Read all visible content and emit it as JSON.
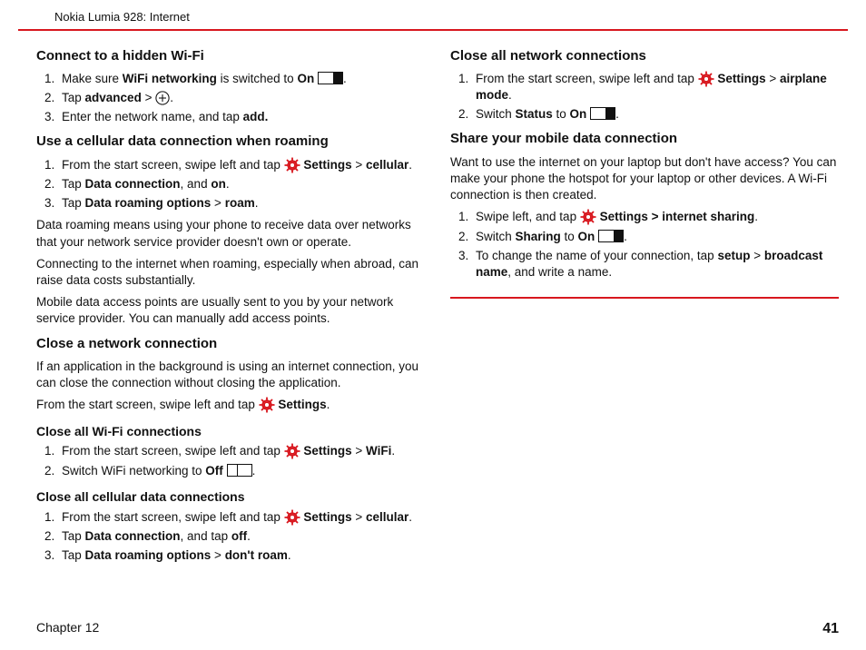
{
  "header": "Nokia Lumia 928: Internet",
  "chapter": "Chapter 12",
  "page": "41",
  "left": {
    "s1": {
      "title": "Connect to a hidden Wi‑Fi",
      "li1a": "Make sure ",
      "li1b": "WiFi networking",
      "li1c": " is switched to ",
      "li1d": "On",
      "li1e": " ",
      "li2a": "Tap ",
      "li2b": "advanced",
      "li2c": " > ",
      "li3a": "Enter the network name, and tap ",
      "li3b": "add."
    },
    "s2": {
      "title": "Use a cellular data connection when roaming",
      "li1a": "From the start screen, swipe left and tap ",
      "li1b": " Settings",
      "li1c": " > ",
      "li1d": "cellular",
      "li1e": ".",
      "li2a": "Tap ",
      "li2b": "Data connection",
      "li2c": ", and ",
      "li2d": "on",
      "li2e": ".",
      "li3a": "Tap ",
      "li3b": "Data roaming options",
      "li3c": " > ",
      "li3d": "roam",
      "li3e": ".",
      "p1": "Data roaming means using your phone to receive data over networks that your network service provider doesn't own or operate.",
      "p2": "Connecting to the internet when roaming, especially when abroad, can raise data costs substantially.",
      "p3": "Mobile data access points are usually sent to you by your network service provider. You can manually add access points."
    },
    "s3": {
      "title": "Close a network connection",
      "p1": "If an application in the background is using an internet connection, you can close the connection without closing the application.",
      "p2a": "From the start screen, swipe left and tap ",
      "p2b": " Settings",
      "p2c": "."
    },
    "s4": {
      "title": "Close all Wi‑Fi connections",
      "li1a": "From the start screen, swipe left and tap ",
      "li1b": " Settings",
      "li1c": " > ",
      "li1d": "WiFi",
      "li1e": ".",
      "li2a": "Switch WiFi networking to ",
      "li2b": "Off",
      "li2c": " "
    },
    "s5": {
      "title": "Close all cellular data connections",
      "li1a": "From the start screen, swipe left and tap ",
      "li1b": " Settings",
      "li1c": " > ",
      "li1d": "cellular",
      "li1e": ".",
      "li2a": "Tap ",
      "li2b": "Data connection",
      "li2c": ", and tap ",
      "li2d": "off",
      "li2e": ".",
      "li3a": "Tap ",
      "li3b": "Data roaming options",
      "li3c": " > ",
      "li3d": "don't roam",
      "li3e": "."
    }
  },
  "right": {
    "s1": {
      "title": "Close all network connections",
      "li1a": "From the start screen, swipe left and tap ",
      "li1b": " Settings",
      "li1c": " > ",
      "li1d": "airplane mode",
      "li1e": ".",
      "li2a": "Switch ",
      "li2b": "Status",
      "li2c": " to ",
      "li2d": "On",
      "li2e": " "
    },
    "s2": {
      "title": "Share your mobile data connection",
      "p1": "Want to use the internet on your laptop but don't have access? You can make your phone the hotspot for your laptop or other devices. A Wi‑Fi connection is then created.",
      "li1a": "Swipe left, and tap ",
      "li1b": " Settings > internet sharing",
      "li1c": ".",
      "li2a": "Switch ",
      "li2b": "Sharing",
      "li2c": " to ",
      "li2d": "On",
      "li2e": " ",
      "li3a": "To change the name of your connection, tap ",
      "li3b": "setup",
      "li3c": " > ",
      "li3d": "broadcast name",
      "li3e": ", and write a name."
    }
  }
}
